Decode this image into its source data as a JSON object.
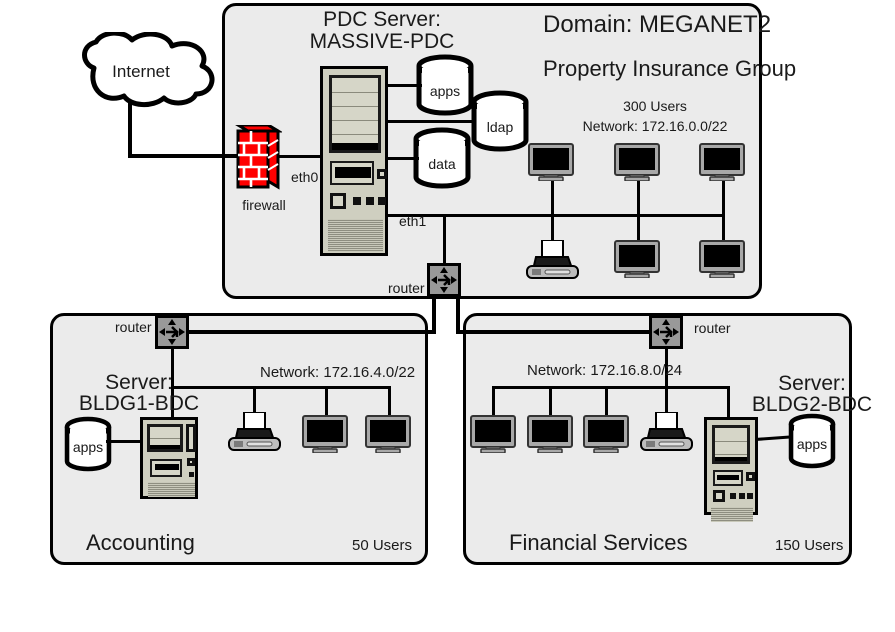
{
  "diagram": {
    "title": "Network topology diagram",
    "background_color": "#ffffff",
    "panel_fill": "#ebebeb",
    "stroke_color": "#000000",
    "firewall_color": "#ff0000",
    "router_color": "#999999",
    "server_case_color": "#cfcfc0"
  },
  "internet": {
    "label": "Internet"
  },
  "top_panel": {
    "domain_label": "Domain: MEGANET2",
    "org_label": "Property Insurance Group",
    "users_label": "300 Users",
    "network_label": "Network: 172.16.0.0/22",
    "server_title_line1": "PDC Server:",
    "server_title_line2": "MASSIVE-PDC",
    "firewall_label": "firewall",
    "eth0_label": "eth0",
    "eth1_label": "eth1",
    "router_label": "router",
    "databases": [
      {
        "name": "apps"
      },
      {
        "name": "ldap"
      },
      {
        "name": "data"
      }
    ],
    "devices": [
      {
        "type": "monitor"
      },
      {
        "type": "monitor"
      },
      {
        "type": "monitor"
      },
      {
        "type": "printer"
      },
      {
        "type": "monitor"
      },
      {
        "type": "monitor"
      }
    ]
  },
  "left_panel": {
    "site_label": "Accounting",
    "users_label": "50 Users",
    "network_label": "Network: 172.16.4.0/22",
    "server_title_line1": "Server:",
    "server_title_line2": "BLDG1-BDC",
    "router_label": "router",
    "databases": [
      {
        "name": "apps"
      }
    ],
    "devices": [
      {
        "type": "printer"
      },
      {
        "type": "monitor"
      },
      {
        "type": "monitor"
      }
    ]
  },
  "right_panel": {
    "site_label": "Financial Services",
    "users_label": "150 Users",
    "network_label": "Network: 172.16.8.0/24",
    "server_title_line1": "Server:",
    "server_title_line2": "BLDG2-BDC",
    "router_label": "router",
    "databases": [
      {
        "name": "apps"
      }
    ],
    "devices": [
      {
        "type": "monitor"
      },
      {
        "type": "monitor"
      },
      {
        "type": "monitor"
      },
      {
        "type": "printer"
      }
    ]
  }
}
